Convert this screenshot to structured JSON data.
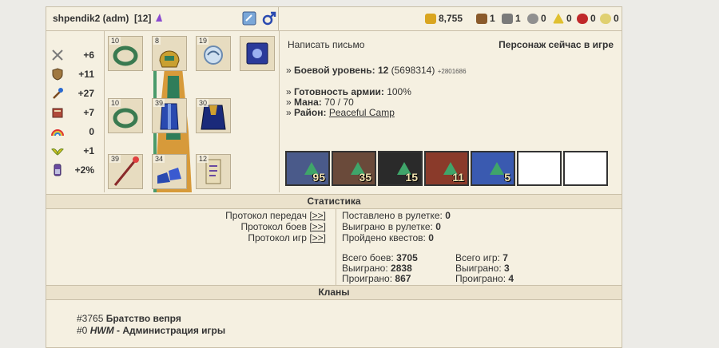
{
  "header": {
    "player_name": "shpendik2 (adm)",
    "player_level": "[12]",
    "resources": [
      {
        "icon": "gold-icon",
        "value": "8,755",
        "color": "#d9a520"
      },
      {
        "icon": "wood-icon",
        "value": "1",
        "color": "#8a5a2b"
      },
      {
        "icon": "ore-icon",
        "value": "1",
        "color": "#7a7a7a"
      },
      {
        "icon": "mercury-icon",
        "value": "0",
        "color": "#909090"
      },
      {
        "icon": "sulfur-icon",
        "value": "0",
        "color": "#e0c030"
      },
      {
        "icon": "crystal-icon",
        "value": "0",
        "color": "#c0282a"
      },
      {
        "icon": "gems-icon",
        "value": "0",
        "color": "#e0d070"
      }
    ]
  },
  "stats": [
    {
      "icon": "attack-swords-icon",
      "value": "+6"
    },
    {
      "icon": "defense-shield-icon",
      "value": "+11"
    },
    {
      "icon": "spellpower-wand-icon",
      "value": "+27"
    },
    {
      "icon": "knowledge-book-icon",
      "value": "+7"
    },
    {
      "icon": "luck-rainbow-icon",
      "value": "0"
    },
    {
      "icon": "morale-icon",
      "value": "+1"
    },
    {
      "icon": "initiative-icon",
      "value": "+2%"
    }
  ],
  "equipment": [
    {
      "name": "ring-left-slot",
      "level": "10"
    },
    {
      "name": "helmet-slot",
      "level": "8"
    },
    {
      "name": "amulet-slot",
      "level": "19"
    },
    {
      "name": "spellbook-slot",
      "level": ""
    },
    {
      "name": "ring-right-slot",
      "level": "10"
    },
    {
      "name": "armor-slot",
      "level": "39"
    },
    {
      "name": "cloak-slot",
      "level": "30"
    },
    {
      "name": "weapon-slot",
      "level": "39"
    },
    {
      "name": "boots-slot",
      "level": "34"
    },
    {
      "name": "scroll-slot",
      "level": "12"
    }
  ],
  "info": {
    "write_letter": "Написать письмо",
    "online_status": "Персонаж сейчас в игре",
    "combat_level_label": "Боевой уровень:",
    "combat_level_value": "12",
    "combat_exp": "(5698314)",
    "combat_exp_delta": "+2801686",
    "army_ready_label": "Готовность армии:",
    "army_ready_value": "100%",
    "mana_label": "Мана:",
    "mana_value": "70 / 70",
    "district_label": "Район:",
    "district_value": "Peaceful Camp"
  },
  "army": [
    {
      "unit": "unit-1",
      "count": "95",
      "color": "#4a5a8a"
    },
    {
      "unit": "unit-2",
      "count": "35",
      "color": "#6a4a3a"
    },
    {
      "unit": "unit-3",
      "count": "15",
      "color": "#2a2a2a"
    },
    {
      "unit": "unit-4",
      "count": "11",
      "color": "#8a3a2a"
    },
    {
      "unit": "unit-5",
      "count": "5",
      "color": "#3a5ab0"
    },
    {
      "unit": "empty",
      "count": ""
    },
    {
      "unit": "empty",
      "count": ""
    }
  ],
  "statistics": {
    "title": "Статистика",
    "protocols": [
      {
        "label": "Протокол передач",
        "link": "[>>]"
      },
      {
        "label": "Протокол боев",
        "link": "[>>]"
      },
      {
        "label": "Протокол игр",
        "link": "[>>]"
      }
    ],
    "roulette_bet_label": "Поставлено в рулетке:",
    "roulette_bet_value": "0",
    "roulette_won_label": "Выиграно в рулетке:",
    "roulette_won_value": "0",
    "quests_label": "Пройдено квестов:",
    "quests_value": "0",
    "battles_total_label": "Всего боев:",
    "battles_total_value": "3705",
    "battles_won_label": "Выиграно:",
    "battles_won_value": "2838",
    "battles_lost_label": "Проиграно:",
    "battles_lost_value": "867",
    "games_total_label": "Всего игр:",
    "games_total_value": "7",
    "games_won_label": "Выиграно:",
    "games_won_value": "3",
    "games_lost_label": "Проиграно:",
    "games_lost_value": "4"
  },
  "clans": {
    "title": "Кланы",
    "items": [
      {
        "id": "#3765",
        "name": "Братство вепря",
        "italic": ""
      },
      {
        "id": "#0",
        "italic": "HWM",
        "name": " - Администрация игры"
      }
    ]
  }
}
